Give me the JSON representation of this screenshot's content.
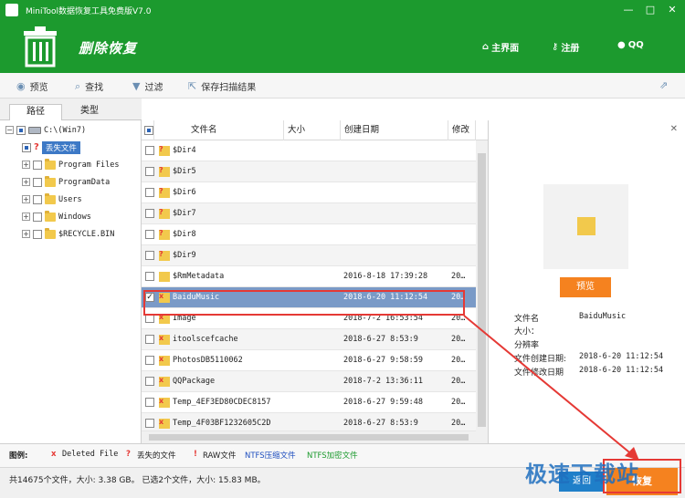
{
  "window": {
    "title": "MiniTool数据恢复工具免费版V7.0",
    "minimize": "—",
    "maximize": "□",
    "close": "✕"
  },
  "header": {
    "title": "删除恢复",
    "nav": [
      {
        "label": "主界面",
        "icon": "home-icon"
      },
      {
        "label": "注册",
        "icon": "key-icon"
      },
      {
        "label": "QQ",
        "icon": "qq-icon"
      }
    ]
  },
  "toolbar": {
    "preview": "预览",
    "find": "查找",
    "filter": "过滤",
    "save_scan": "保存扫描结果"
  },
  "tabs": {
    "path": "路径",
    "type": "类型"
  },
  "tree": {
    "drive": "C:\\(Win7)",
    "items": [
      {
        "label": "丢失文件"
      },
      {
        "label": "Program Files"
      },
      {
        "label": "ProgramData"
      },
      {
        "label": "Users"
      },
      {
        "label": "Windows"
      },
      {
        "label": "$RECYCLE.BIN"
      }
    ]
  },
  "list": {
    "columns": [
      "文件名",
      "大小",
      "创建日期",
      "修改"
    ],
    "rows": [
      {
        "name": "$Dir4",
        "date": "",
        "mod": ""
      },
      {
        "name": "$Dir5",
        "date": "",
        "mod": ""
      },
      {
        "name": "$Dir6",
        "date": "",
        "mod": ""
      },
      {
        "name": "$Dir7",
        "date": "",
        "mod": ""
      },
      {
        "name": "$Dir8",
        "date": "",
        "mod": ""
      },
      {
        "name": "$Dir9",
        "date": "",
        "mod": ""
      },
      {
        "name": "$RmMetadata",
        "date": "2016-8-18 17:39:28",
        "mod": "20…"
      },
      {
        "name": "BaiduMusic",
        "date": "2018-6-20 11:12:54",
        "mod": "20…"
      },
      {
        "name": "Image",
        "date": "2018-7-2 16:53:54",
        "mod": "20…"
      },
      {
        "name": "itoolscefcache",
        "date": "2018-6-27 8:53:9",
        "mod": "20…"
      },
      {
        "name": "PhotosDB5110062",
        "date": "2018-6-27 9:58:59",
        "mod": "20…"
      },
      {
        "name": "QQPackage",
        "date": "2018-7-2 13:36:11",
        "mod": "20…"
      },
      {
        "name": "Temp_4EF3ED80CDEC8157",
        "date": "2018-6-27 9:59:48",
        "mod": "20…"
      },
      {
        "name": "Temp_4F03BF1232605C2D",
        "date": "2018-6-27 8:53:9",
        "mod": "20…"
      }
    ]
  },
  "preview": {
    "close": "✕",
    "button": "预览",
    "labels": {
      "filename": "文件名",
      "size": "大小：",
      "resolution": "分辨率",
      "created": "文件创建日期:",
      "modified": "文件修改日期"
    },
    "values": {
      "filename": "BaiduMusic",
      "created": "2018-6-20 11:12:54",
      "modified": "2018-6-20 11:12:54"
    }
  },
  "legend": {
    "title": "图例:",
    "deleted": "Deleted File",
    "lost": "丢失的文件",
    "raw": "RAW文件",
    "ntfs_compressed": "NTFS压缩文件",
    "ntfs_encrypted": "NTFS加密文件",
    "colors": {
      "compressed": "#1f4fbf",
      "encrypted": "#1c9a2e",
      "mark": "#e53935"
    }
  },
  "status": {
    "text": "共14675个文件，大小: 3.38 GB。 已选2个文件，大小: 15.83 MB。",
    "back": "返回",
    "recover": "恢复"
  },
  "watermark": "极速下载站",
  "colors": {
    "brand_green": "#1c9a2e",
    "accent_orange": "#f5821f",
    "select_blue": "#3d79c6"
  }
}
